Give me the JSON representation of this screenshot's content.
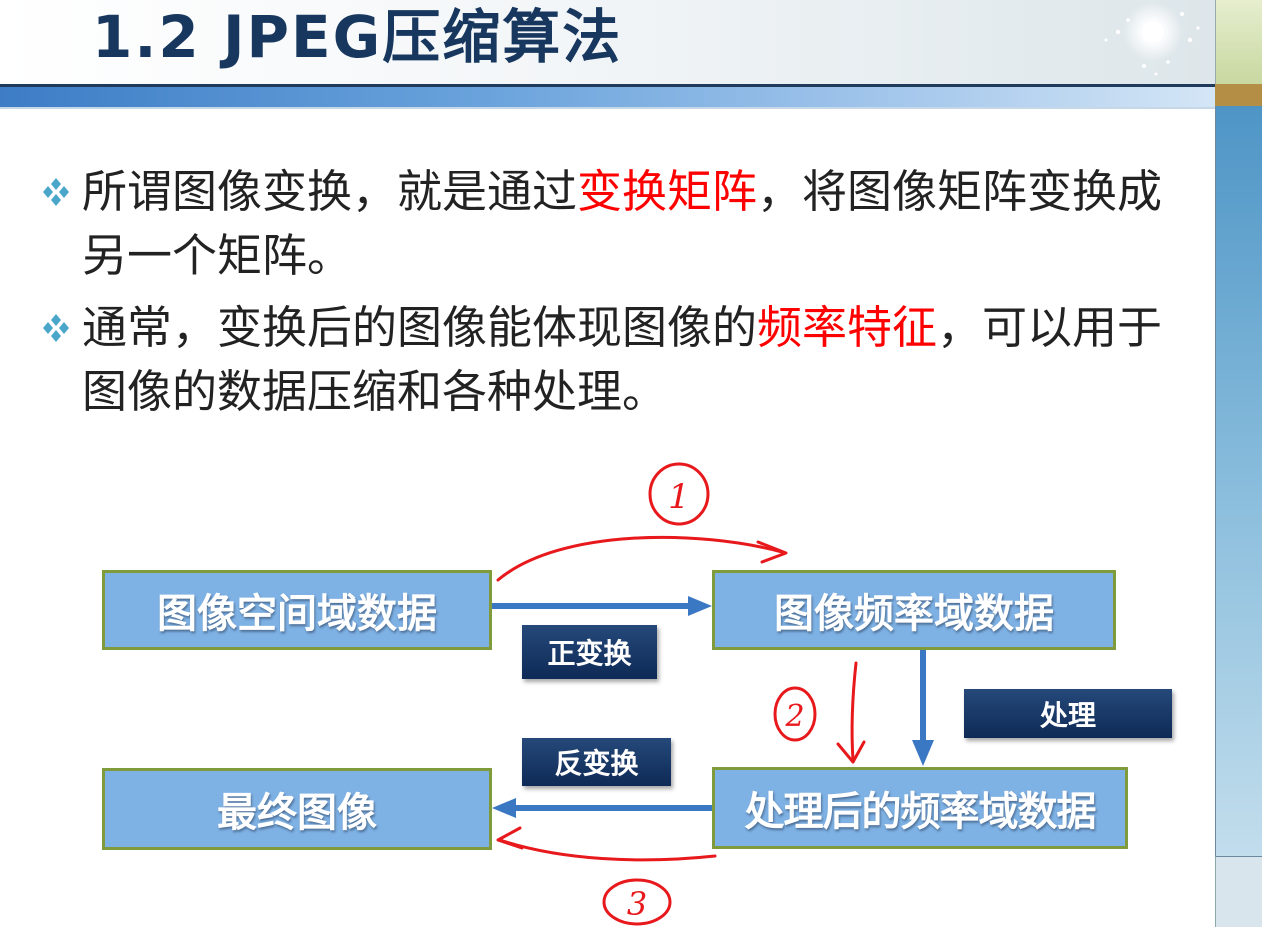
{
  "slide": {
    "title": "1.2 JPEG压缩算法"
  },
  "bullets": [
    {
      "before": "所谓图像变换，就是通过",
      "highlight": "变换矩阵",
      "after": "，将图像矩阵变换成另一个矩阵。"
    },
    {
      "before": "通常，变换后的图像能体现图像的",
      "highlight": "频率特征",
      "after": "，可以用于图像的数据压缩和各种处理。"
    }
  ],
  "diagram": {
    "boxes": {
      "spatial": "图像空间域数据",
      "frequency": "图像频率域数据",
      "final": "最终图像",
      "processed": "处理后的频率域数据"
    },
    "labels": {
      "forward": "正变换",
      "process": "处理",
      "inverse": "反变换"
    },
    "annotations": [
      "1",
      "2",
      "3"
    ]
  },
  "colors": {
    "title": "#17375e",
    "highlight": "#ff0000",
    "box_fill": "#7eb1e4",
    "box_border": "#7f9b3c",
    "arrow": "#3b78c3",
    "label_fill": "#0e2a56",
    "handwriting": "#e8191c"
  }
}
